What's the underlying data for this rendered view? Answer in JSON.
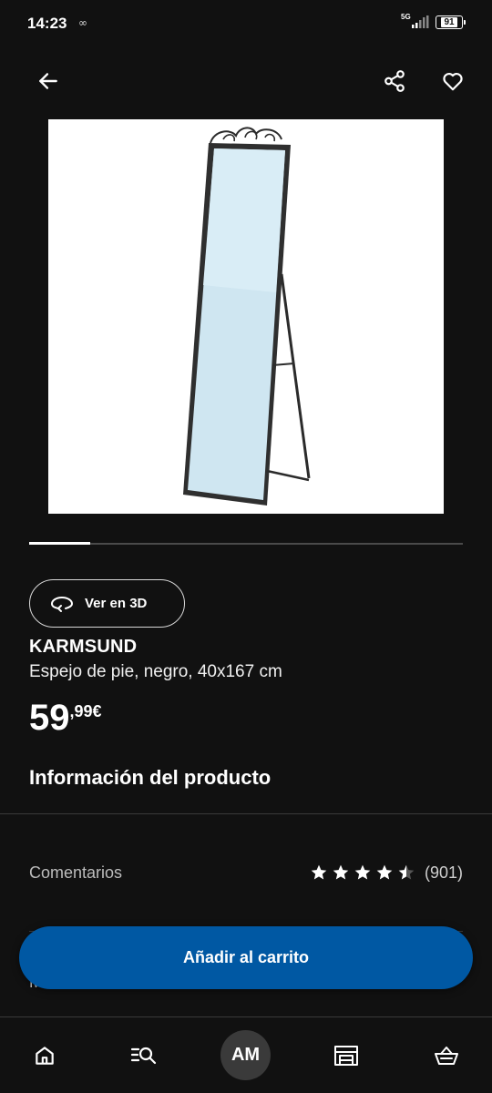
{
  "status_bar": {
    "time": "14:23",
    "vpn_glyph": "∞",
    "network": "5G",
    "battery": "91"
  },
  "product": {
    "view_3d_label": "Ver en 3D",
    "name": "KARMSUND",
    "description": "Espejo de pie, negro, 40x167 cm",
    "price_integer": "59",
    "price_decimal": ",99",
    "price_currency": "€",
    "image_progress": 0.14
  },
  "sections": {
    "info_title": "Información del producto",
    "reviews_label": "Comentarios",
    "reviews_rating": 4.5,
    "reviews_count": "(901)",
    "dimensions_label": "Medidas"
  },
  "actions": {
    "add_to_cart": "Añadir al carrito"
  },
  "bottom_nav": {
    "avatar_initials": "AM",
    "items": [
      "home-icon",
      "search-list-icon",
      "account",
      "store-icon",
      "basket-icon"
    ]
  },
  "colors": {
    "background": "#111111",
    "primary_button": "#0058a3",
    "text": "#ffffff",
    "muted_text": "#bdbdbd"
  }
}
